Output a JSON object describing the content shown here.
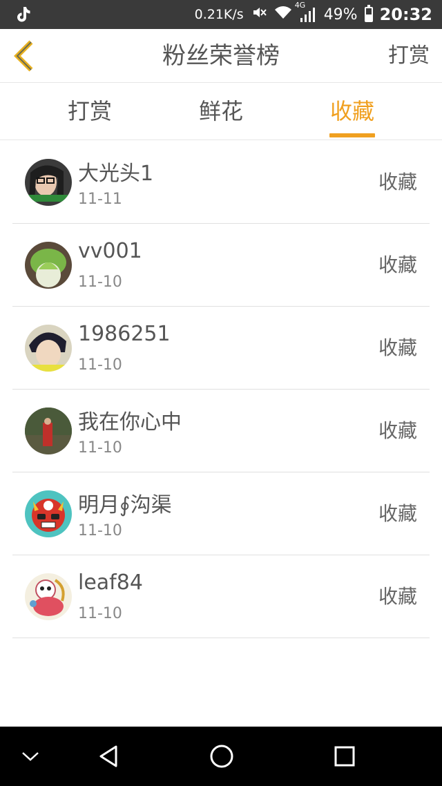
{
  "status_bar": {
    "net_speed": "0.21K/s",
    "network_type": "4G",
    "battery": "49%",
    "time": "20:32",
    "icons": [
      "tiktok-icon",
      "mute-icon",
      "wifi-icon",
      "signal-icon",
      "battery-icon"
    ]
  },
  "header": {
    "title": "粉丝荣誉榜",
    "action_label": "打赏",
    "back_icon": "chevron-left-icon"
  },
  "tabs": [
    {
      "label": "打赏",
      "active": false
    },
    {
      "label": "鲜花",
      "active": false
    },
    {
      "label": "收藏",
      "active": true
    }
  ],
  "list": [
    {
      "name": "大光头1",
      "date": "11-11",
      "action": "收藏"
    },
    {
      "name": "vv001",
      "date": "11-10",
      "action": "收藏"
    },
    {
      "name": "1986251",
      "date": "11-10",
      "action": "收藏"
    },
    {
      "name": "我在你心中",
      "date": "11-10",
      "action": "收藏"
    },
    {
      "name": "明月∮沟渠",
      "date": "11-10",
      "action": "收藏"
    },
    {
      "name": "leaf84",
      "date": "11-10",
      "action": "收藏"
    }
  ],
  "colors": {
    "accent": "#f0a020",
    "status_bar": "#3a3a3a",
    "nav_bar": "#000000"
  },
  "nav_bar": {
    "icons": [
      "chevron-down-icon",
      "back-triangle-icon",
      "home-circle-icon",
      "recents-square-icon"
    ]
  }
}
